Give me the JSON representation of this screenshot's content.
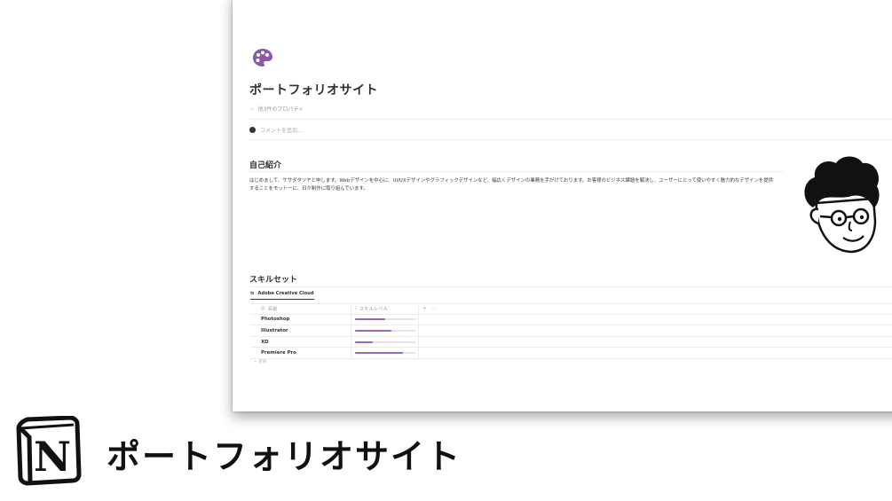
{
  "page": {
    "title": "ポートフォリオサイト",
    "properties_toggle": "他3件のプロパティ",
    "comment_placeholder": "コメントを追加...",
    "palette_icon": "palette-icon",
    "accent_color": "#9a68b8"
  },
  "intro": {
    "heading": "自己紹介",
    "text": "はじめまして、ササダタツヤと申します。Webデザインを中心に、UI/UXデザインやグラフィックデザインなど、幅広くデザインの業務を手がけております。お客様のビジネス課題を解決し、ユーザーにとって使いやすく魅力的なデザインを提供することをモットーに、日々制作に取り組んでいます。"
  },
  "skills": {
    "heading": "スキルセット",
    "tab_label": "Adobe Creative Cloud",
    "columns": {
      "name": "名前",
      "level": "スキルレベル",
      "add": "+",
      "more": "···"
    },
    "rows": [
      {
        "name": "Photoshop",
        "level": 0.5
      },
      {
        "name": "Illustrator",
        "level": 0.6
      },
      {
        "name": "XD",
        "level": 0.3
      },
      {
        "name": "Premiere Pro",
        "level": 0.8
      }
    ],
    "new_row": "+ 新規"
  },
  "branding": {
    "title": "ポートフォリオサイト",
    "logo": "notion-logo",
    "logo_letter": "N"
  }
}
